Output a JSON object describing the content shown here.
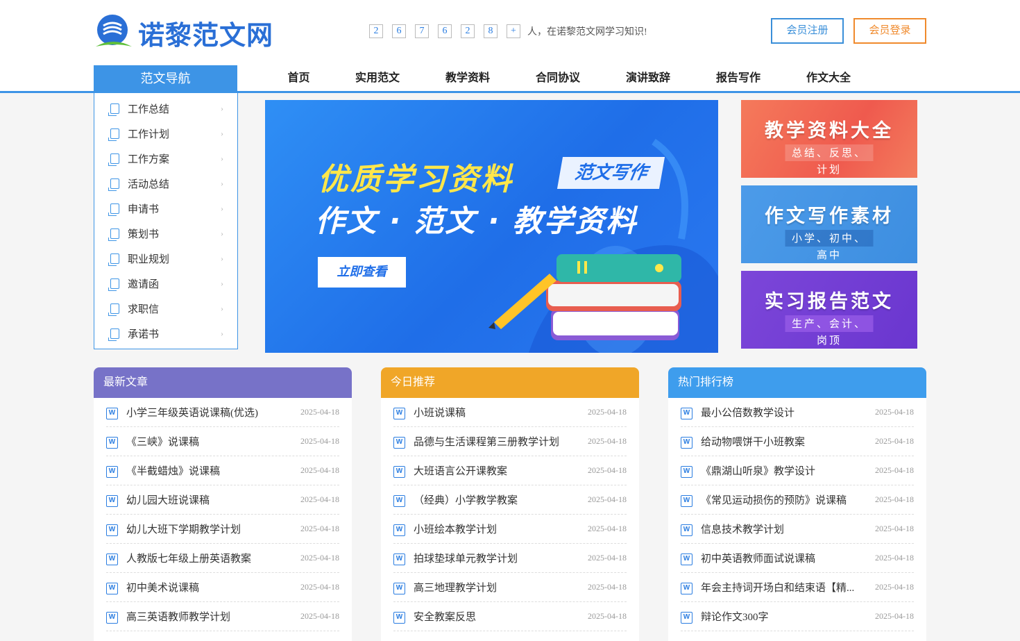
{
  "header": {
    "logo_text": "诺黎范文网",
    "counter_digits": [
      "2",
      "6",
      "7",
      "6",
      "2",
      "8",
      "+"
    ],
    "counter_text": "人，在诺黎范文网学习知识!",
    "register_label": "会员注册",
    "login_label": "会员登录"
  },
  "nav": {
    "title": "范文导航",
    "items": [
      {
        "label": "首页"
      },
      {
        "label": "实用范文"
      },
      {
        "label": "教学资料"
      },
      {
        "label": "合同协议"
      },
      {
        "label": "演讲致辞"
      },
      {
        "label": "报告写作"
      },
      {
        "label": "作文大全"
      }
    ]
  },
  "sidebar": {
    "items": [
      {
        "label": "工作总结"
      },
      {
        "label": "工作计划"
      },
      {
        "label": "工作方案"
      },
      {
        "label": "活动总结"
      },
      {
        "label": "申请书"
      },
      {
        "label": "策划书"
      },
      {
        "label": "职业规划"
      },
      {
        "label": "邀请函"
      },
      {
        "label": "求职信"
      },
      {
        "label": "承诺书"
      }
    ]
  },
  "banner": {
    "headline": "优质学习资料",
    "tag": "范文写作",
    "subline": "作文 · 范文 · 教学资料",
    "cta": "立即查看"
  },
  "promos": [
    {
      "title": "教学资料大全",
      "sub": "总结、反思、计划"
    },
    {
      "title": "作文写作素材",
      "sub": "小学、初中、高中"
    },
    {
      "title": "实习报告范文",
      "sub": "生产、会计、岗顶"
    }
  ],
  "columns": [
    {
      "title": "最新文章",
      "items": [
        {
          "title": "小学三年级英语说课稿(优选)",
          "date": "2025-04-18"
        },
        {
          "title": "《三峡》说课稿",
          "date": "2025-04-18"
        },
        {
          "title": "《半截蜡烛》说课稿",
          "date": "2025-04-18"
        },
        {
          "title": "幼儿园大班说课稿",
          "date": "2025-04-18"
        },
        {
          "title": "幼儿大班下学期教学计划",
          "date": "2025-04-18"
        },
        {
          "title": "人教版七年级上册英语教案",
          "date": "2025-04-18"
        },
        {
          "title": "初中美术说课稿",
          "date": "2025-04-18"
        },
        {
          "title": "高三英语教师教学计划",
          "date": "2025-04-18"
        }
      ]
    },
    {
      "title": "今日推荐",
      "items": [
        {
          "title": "小班说课稿",
          "date": "2025-04-18"
        },
        {
          "title": "品德与生活课程第三册教学计划",
          "date": "2025-04-18"
        },
        {
          "title": "大班语言公开课教案",
          "date": "2025-04-18"
        },
        {
          "title": "（经典）小学教学教案",
          "date": "2025-04-18"
        },
        {
          "title": "小班绘本教学计划",
          "date": "2025-04-18"
        },
        {
          "title": "拍球垫球单元教学计划",
          "date": "2025-04-18"
        },
        {
          "title": "高三地理教学计划",
          "date": "2025-04-18"
        },
        {
          "title": "安全教案反思",
          "date": "2025-04-18"
        }
      ]
    },
    {
      "title": "热门排行榜",
      "items": [
        {
          "title": "最小公倍数教学设计",
          "date": "2025-04-18"
        },
        {
          "title": "给动物喂饼干小班教案",
          "date": "2025-04-18"
        },
        {
          "title": "《鼎湖山听泉》教学设计",
          "date": "2025-04-18"
        },
        {
          "title": "《常见运动损伤的预防》说课稿",
          "date": "2025-04-18"
        },
        {
          "title": "信息技术教学计划",
          "date": "2025-04-18"
        },
        {
          "title": "初中英语教师面试说课稿",
          "date": "2025-04-18"
        },
        {
          "title": "年会主持词开场白和结束语【精...",
          "date": "2025-04-18"
        },
        {
          "title": "辩论作文300字",
          "date": "2025-04-18"
        }
      ]
    }
  ]
}
